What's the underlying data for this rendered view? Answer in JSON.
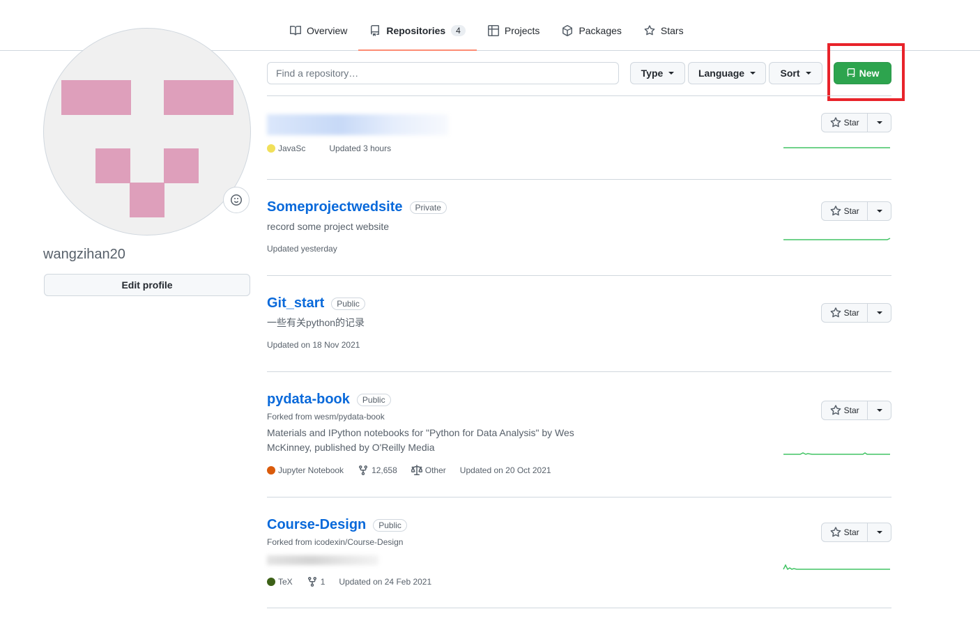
{
  "nav": {
    "tabs": [
      {
        "label": "Overview",
        "icon": "book-icon"
      },
      {
        "label": "Repositories",
        "icon": "repo-icon",
        "count": "4",
        "active": true
      },
      {
        "label": "Projects",
        "icon": "table-icon"
      },
      {
        "label": "Packages",
        "icon": "package-icon"
      },
      {
        "label": "Stars",
        "icon": "star-icon"
      }
    ]
  },
  "profile": {
    "username": "wangzihan20",
    "edit_label": "Edit profile",
    "avatar_color": "#de9fbb"
  },
  "filters": {
    "search_placeholder": "Find a repository…",
    "type_label": "Type",
    "language_label": "Language",
    "sort_label": "Sort",
    "new_label": "New",
    "new_color": "#2da44e",
    "highlight_color": "#e8232a"
  },
  "repos": [
    {
      "name": "",
      "visibility": "",
      "language": "JavaSc",
      "language_color": "#f1e05a",
      "updated": "Updated 3 hours",
      "star_label": "Star"
    },
    {
      "name": "Someprojectwedsite",
      "visibility": "Private",
      "description": "record some project website",
      "updated": "Updated yesterday",
      "star_label": "Star"
    },
    {
      "name": "Git_start",
      "visibility": "Public",
      "description": "一些有关python的记录",
      "updated": "Updated on 18 Nov 2021",
      "star_label": "Star"
    },
    {
      "name": "pydata-book",
      "visibility": "Public",
      "forked": "Forked from wesm/pydata-book",
      "description": "Materials and IPython notebooks for \"Python for Data Analysis\" by Wes McKinney, published by O'Reilly Media",
      "language": "Jupyter Notebook",
      "language_color": "#da5b0b",
      "forks": "12,658",
      "license": "Other",
      "updated": "Updated on 20 Oct 2021",
      "star_label": "Star"
    },
    {
      "name": "Course-Design",
      "visibility": "Public",
      "forked": "Forked from icodexin/Course-Design",
      "language": "TeX",
      "language_color": "#3d6117",
      "forks": "1",
      "updated": "Updated on 24 Feb 2021",
      "star_label": "Star"
    }
  ]
}
